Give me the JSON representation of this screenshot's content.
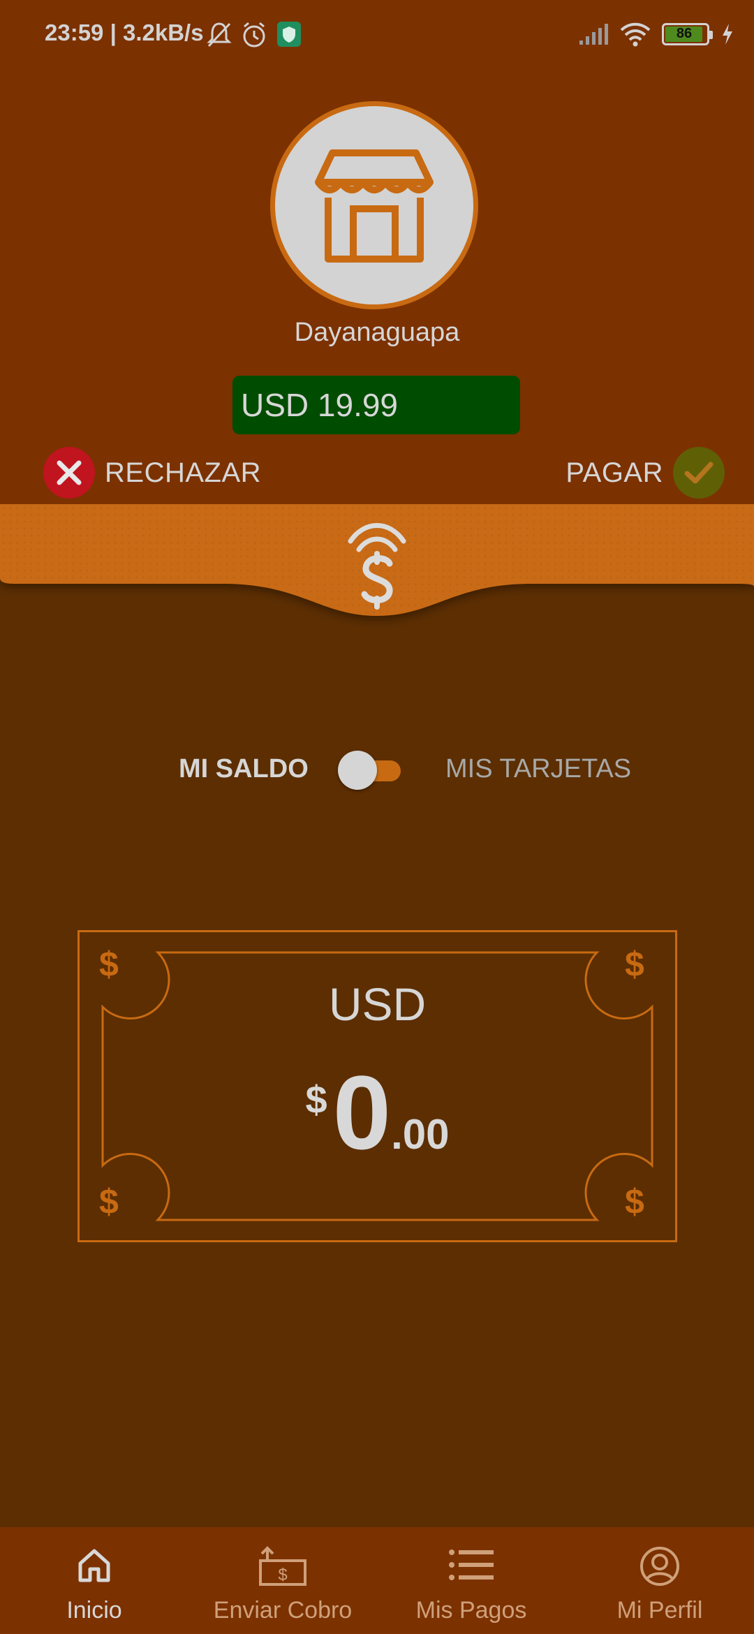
{
  "status_bar": {
    "time": "23:59 | 3.2kB/s",
    "battery": "86"
  },
  "request": {
    "merchant_name": "Dayanaguapa",
    "amount": "USD 19.99",
    "reject_label": "RECHAZAR",
    "pay_label": "PAGAR"
  },
  "source_toggle": {
    "left_label": "MI SALDO",
    "right_label": "MIS TARJETAS",
    "selected": "MI SALDO"
  },
  "balance": {
    "currency": "USD",
    "symbol": "$",
    "integer": "0",
    "decimal": ".00"
  },
  "bottom_nav": {
    "items": [
      {
        "label": "Inicio",
        "icon": "home-icon",
        "active": true
      },
      {
        "label": "Enviar Cobro",
        "icon": "send-charge-icon",
        "active": false
      },
      {
        "label": "Mis Pagos",
        "icon": "list-icon",
        "active": false
      },
      {
        "label": "Mi Perfil",
        "icon": "profile-icon",
        "active": false
      }
    ]
  },
  "colors": {
    "background": "#5c2e02",
    "header": "#7c3100",
    "accent_orange": "#c86a12",
    "amount_green": "#004c00",
    "reject_red": "#c0141f",
    "pay_olive": "#5f6006"
  }
}
